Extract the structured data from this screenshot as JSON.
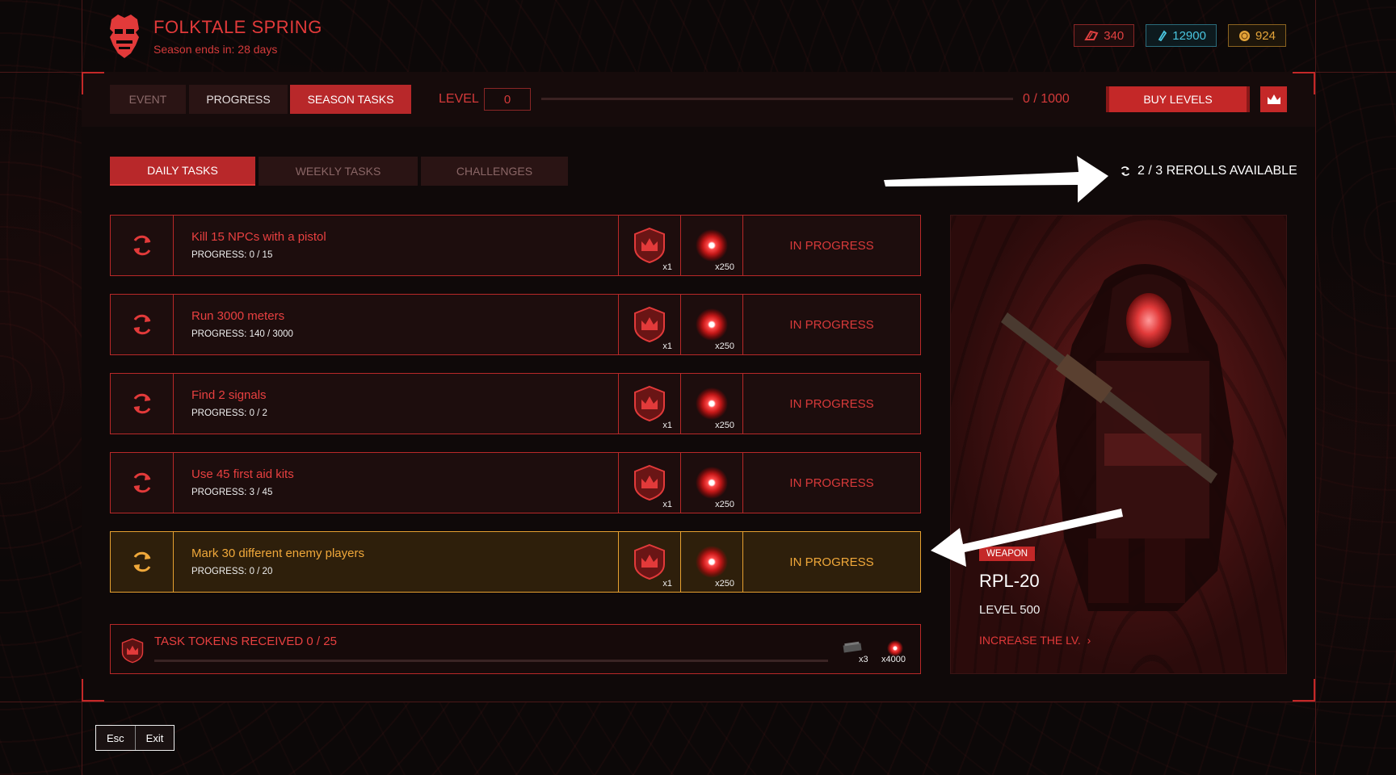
{
  "header": {
    "title": "FOLKTALE SPRING",
    "subtitle": "Season ends in: 28 days"
  },
  "currencies": [
    {
      "value": "340",
      "icon": "red-token-icon"
    },
    {
      "value": "12900",
      "icon": "cyan-gem-icon"
    },
    {
      "value": "924",
      "icon": "gold-coin-icon"
    }
  ],
  "top_tabs": {
    "event": "EVENT",
    "progress": "PROGRESS",
    "season_tasks": "SEASON TASKS"
  },
  "level": {
    "label": "LEVEL",
    "value": "0",
    "count": "0 / 1000",
    "progress_fraction": 0
  },
  "buy_levels": "BUY LEVELS",
  "sub_tabs": {
    "daily": "DAILY TASKS",
    "weekly": "WEEKLY TASKS",
    "challenges": "CHALLENGES"
  },
  "rerolls": "2 / 3 REROLLS AVAILABLE",
  "tasks": [
    {
      "name": "Kill 15 NPCs with a pistol",
      "progress": "PROGRESS: 0 / 15",
      "token_qty": "x1",
      "orb_qty": "x250",
      "status": "IN PROGRESS"
    },
    {
      "name": "Run 3000 meters",
      "progress": "PROGRESS: 140 / 3000",
      "token_qty": "x1",
      "orb_qty": "x250",
      "status": "IN PROGRESS"
    },
    {
      "name": "Find 2 signals",
      "progress": "PROGRESS: 0 / 2",
      "token_qty": "x1",
      "orb_qty": "x250",
      "status": "IN PROGRESS"
    },
    {
      "name": "Use 45 first aid kits",
      "progress": "PROGRESS: 3 / 45",
      "token_qty": "x1",
      "orb_qty": "x250",
      "status": "IN PROGRESS"
    },
    {
      "name": "Mark 30 different enemy players",
      "progress": "PROGRESS: 0 / 20",
      "token_qty": "x1",
      "orb_qty": "x250",
      "status": "IN PROGRESS"
    }
  ],
  "tokens": {
    "label": "TASK TOKENS RECEIVED 0 / 25",
    "progress_fraction": 0,
    "reward1_qty": "x3",
    "reward2_qty": "x4000"
  },
  "weapon": {
    "tag": "WEAPON",
    "name": "RPL-20",
    "level": "LEVEL 500",
    "link": "INCREASE THE LV."
  },
  "footer": {
    "key": "Esc",
    "label": "Exit"
  },
  "colors": {
    "accent_red": "#c42828",
    "highlight_gold": "#e6a030",
    "cyan": "#4ac6e0"
  }
}
